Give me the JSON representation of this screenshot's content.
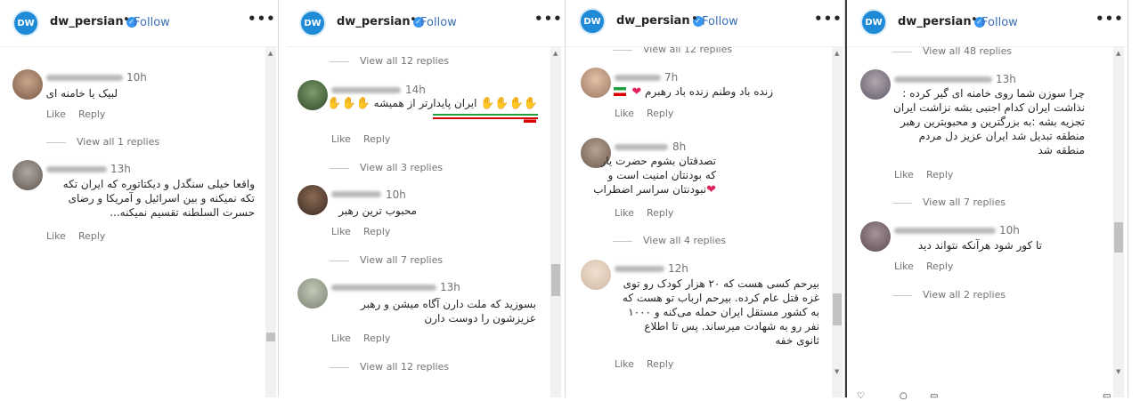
{
  "header": {
    "username": "dw_persian",
    "dot": "•",
    "follow_label": "Follow",
    "more_label": "•••",
    "logo_text": "DW"
  },
  "labels": {
    "like": "Like",
    "reply": "Reply"
  },
  "panel1": {
    "c1": {
      "time": "10h",
      "text": "لبیک یا خامنه ای",
      "view": "View all 1 replies"
    },
    "c2": {
      "time": "13h",
      "lines": [
        "واقعا خیلی سنگدل و دیکتاتوره که ایران تکه",
        "تکه نمیکنه و بین اسرائیل و آمریکا و رضای",
        "حسرت السلطنه تقسیم نمیکنه..."
      ]
    }
  },
  "panel2": {
    "top_view": "View all 12 replies",
    "c1": {
      "time": "14h",
      "text": "ایران پایدارتر از همیشه",
      "view": "View all 3 replies"
    },
    "c2": {
      "time": "10h",
      "text": "محبوب ترین رهبر",
      "view": "View all 7 replies"
    },
    "c3": {
      "time": "13h",
      "lines": [
        "بسوزید که ملت دارن آگاه میشن و رهبر",
        "عزیزشون را دوست دارن"
      ],
      "view": "View all 12 replies"
    }
  },
  "panel3": {
    "top_view": "View all 12 replies",
    "c1": {
      "time": "7h",
      "text": "زنده باد وطنم زنده باد رهبرم"
    },
    "c2": {
      "time": "8h",
      "lines": [
        "تصدقتان بشوم حضرت یار",
        "که بودنتان امنیت است و",
        "نبودنتان سراسر اضطراب"
      ],
      "view": "View all 4 replies"
    },
    "c3": {
      "time": "12h",
      "lines": [
        "بیرحم کسی هست که ۲۰ هزار کودک رو توی",
        "غزه قتل عام کرده. بیرحم ارباب تو هست که",
        "به کشور مستقل ایران حمله می‌کنه و ۱۰۰۰",
        "نفر رو به شهادت میرساند. پس تا اطلاع",
        "ثانوی خفه"
      ]
    }
  },
  "panel4": {
    "top_view": "View all 48 replies",
    "c1": {
      "time": "13h",
      "lines": [
        "چرا سوزن شما روی خامنه ای گیر کرده :",
        "نذاشت ایران کدام اجنبی بشه نزاشت ایران",
        "تجزیه بشه :به بزرگترین و محبوبترین رهبر",
        "منطقه تبدیل شد ایران عزیز دل مردم",
        "منطقه شد"
      ],
      "view": "View all 7 replies"
    },
    "c2": {
      "time": "10h",
      "text": "تا کور شود هرآنکه نتواند دید",
      "view": "View all 2 replies"
    }
  },
  "colors": {
    "accent": "#3b6fb6",
    "verified": "#3897f0",
    "heart": "#e0245e"
  },
  "icons": [
    "dw-logo-icon",
    "verified-badge-icon",
    "more-options-icon",
    "heart-emoji-icon",
    "iran-flag-icon",
    "raised-hand-emoji-icon",
    "scroll-up-arrow-icon",
    "scroll-down-arrow-icon"
  ]
}
